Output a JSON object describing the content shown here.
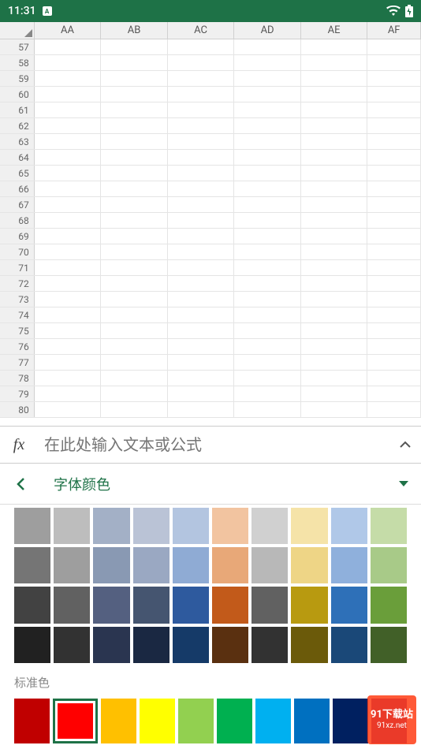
{
  "status": {
    "time": "11:31",
    "app_indicator": "A"
  },
  "columns": [
    "AA",
    "AB",
    "AC",
    "AD",
    "AE",
    "AF"
  ],
  "rows": [
    57,
    58,
    59,
    60,
    61,
    62,
    63,
    64,
    65,
    66,
    67,
    68,
    69,
    70,
    71,
    72,
    73,
    74,
    75,
    76,
    77,
    78,
    79,
    80
  ],
  "formula": {
    "fx": "fx",
    "placeholder": "在此处输入文本或公式"
  },
  "panel": {
    "title": "字体颜色"
  },
  "theme_colors": [
    [
      "#9e9e9e",
      "#bdbdbd",
      "#a3b0c6",
      "#bac3d6",
      "#b3c5e0",
      "#f2c4a0",
      "#d0d0d0",
      "#f5e3a8",
      "#b0c8e8",
      "#c5dca8"
    ],
    [
      "#757575",
      "#9e9e9e",
      "#8999b3",
      "#9aa8c2",
      "#8fabd4",
      "#e8a878",
      "#b8b8b8",
      "#eed586",
      "#8fb0dc",
      "#a8ca88"
    ],
    [
      "#424242",
      "#616161",
      "#546080",
      "#455570",
      "#2e5a9e",
      "#c25a1a",
      "#616161",
      "#b89a10",
      "#2e70b8",
      "#6a9e3a"
    ],
    [
      "#212121",
      "#323232",
      "#2a3550",
      "#1a2842",
      "#153a68",
      "#5a3010",
      "#323232",
      "#6b5a0a",
      "#1a4878",
      "#416028"
    ]
  ],
  "standard_label": "标准色",
  "standard_colors": [
    {
      "color": "#c00000",
      "selected": false
    },
    {
      "color": "#ff0000",
      "selected": true
    },
    {
      "color": "#ffc000",
      "selected": false
    },
    {
      "color": "#ffff00",
      "selected": false
    },
    {
      "color": "#92d050",
      "selected": false
    },
    {
      "color": "#00b050",
      "selected": false
    },
    {
      "color": "#00b0f0",
      "selected": false
    },
    {
      "color": "#0070c0",
      "selected": false
    },
    {
      "color": "#002060",
      "selected": false
    },
    {
      "color": "#7030a0",
      "selected": false
    }
  ],
  "watermark": {
    "line1": "91下载站",
    "line2": "91xz.net"
  }
}
